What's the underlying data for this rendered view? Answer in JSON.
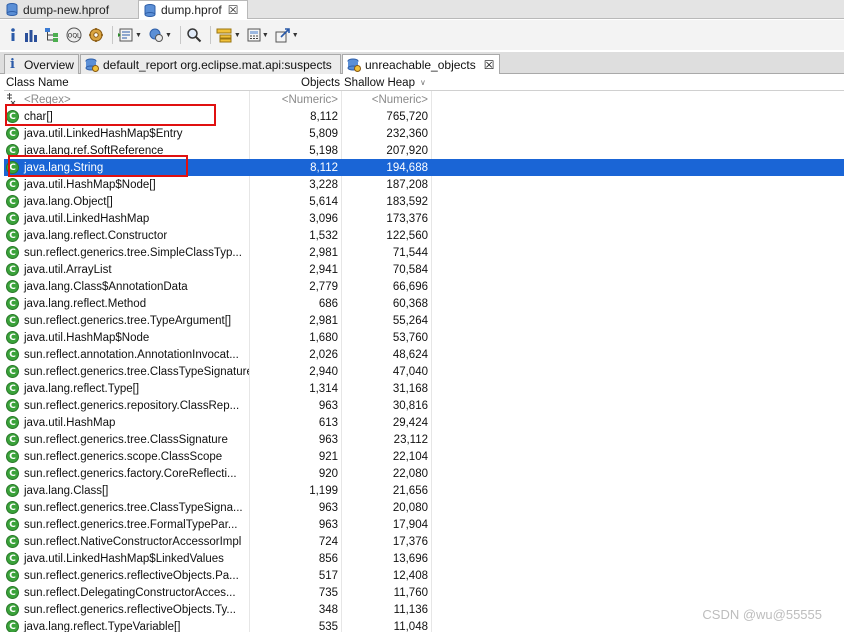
{
  "editor_tabs": [
    {
      "label": "dump-new.hprof",
      "active": false
    },
    {
      "label": "dump.hprof",
      "active": true,
      "close": "☒"
    }
  ],
  "toolbar": {
    "buttons": [
      {
        "icon": "info-icon"
      },
      {
        "icon": "histogram-icon"
      },
      {
        "icon": "dominator-tree-icon"
      },
      {
        "icon": "oql-icon"
      },
      {
        "icon": "heap-dump-overview-icon"
      },
      {
        "icon": "query-browser-icon"
      },
      {
        "icon": "find-object-icon"
      },
      {
        "icon": "search-icon"
      },
      {
        "icon": "group-by-icon"
      },
      {
        "icon": "calculator-icon"
      },
      {
        "icon": "export-icon"
      }
    ]
  },
  "view_tabs": [
    {
      "label": "Overview",
      "icon": "info-icon"
    },
    {
      "label": "default_report  org.eclipse.mat.api:suspects",
      "icon": "report-icon"
    },
    {
      "label": "unreachable_objects",
      "icon": "report-icon",
      "active": true,
      "close": "☒"
    }
  ],
  "table": {
    "columns": [
      "Class Name",
      "Objects",
      "Shallow Heap"
    ],
    "filter_row": [
      "<Regex>",
      "<Numeric>",
      "<Numeric>"
    ],
    "rows": [
      {
        "name": "char[]",
        "objects": "8,112",
        "shallow_heap": "765,720"
      },
      {
        "name": "java.util.LinkedHashMap$Entry",
        "objects": "5,809",
        "shallow_heap": "232,360"
      },
      {
        "name": "java.lang.ref.SoftReference",
        "objects": "5,198",
        "shallow_heap": "207,920"
      },
      {
        "name": "java.lang.String",
        "objects": "8,112",
        "shallow_heap": "194,688",
        "selected": true
      },
      {
        "name": "java.util.HashMap$Node[]",
        "objects": "3,228",
        "shallow_heap": "187,208"
      },
      {
        "name": "java.lang.Object[]",
        "objects": "5,614",
        "shallow_heap": "183,592"
      },
      {
        "name": "java.util.LinkedHashMap",
        "objects": "3,096",
        "shallow_heap": "173,376"
      },
      {
        "name": "java.lang.reflect.Constructor",
        "objects": "1,532",
        "shallow_heap": "122,560"
      },
      {
        "name": "sun.reflect.generics.tree.SimpleClassTyp...",
        "objects": "2,981",
        "shallow_heap": "71,544"
      },
      {
        "name": "java.util.ArrayList",
        "objects": "2,941",
        "shallow_heap": "70,584"
      },
      {
        "name": "java.lang.Class$AnnotationData",
        "objects": "2,779",
        "shallow_heap": "66,696"
      },
      {
        "name": "java.lang.reflect.Method",
        "objects": "686",
        "shallow_heap": "60,368"
      },
      {
        "name": "sun.reflect.generics.tree.TypeArgument[]",
        "objects": "2,981",
        "shallow_heap": "55,264"
      },
      {
        "name": "java.util.HashMap$Node",
        "objects": "1,680",
        "shallow_heap": "53,760"
      },
      {
        "name": "sun.reflect.annotation.AnnotationInvocat...",
        "objects": "2,026",
        "shallow_heap": "48,624"
      },
      {
        "name": "sun.reflect.generics.tree.ClassTypeSignature",
        "objects": "2,940",
        "shallow_heap": "47,040"
      },
      {
        "name": "java.lang.reflect.Type[]",
        "objects": "1,314",
        "shallow_heap": "31,168"
      },
      {
        "name": "sun.reflect.generics.repository.ClassRep...",
        "objects": "963",
        "shallow_heap": "30,816"
      },
      {
        "name": "java.util.HashMap",
        "objects": "613",
        "shallow_heap": "29,424"
      },
      {
        "name": "sun.reflect.generics.tree.ClassSignature",
        "objects": "963",
        "shallow_heap": "23,112"
      },
      {
        "name": "sun.reflect.generics.scope.ClassScope",
        "objects": "921",
        "shallow_heap": "22,104"
      },
      {
        "name": "sun.reflect.generics.factory.CoreReflecti...",
        "objects": "920",
        "shallow_heap": "22,080"
      },
      {
        "name": "java.lang.Class[]",
        "objects": "1,199",
        "shallow_heap": "21,656"
      },
      {
        "name": "sun.reflect.generics.tree.ClassTypeSigna...",
        "objects": "963",
        "shallow_heap": "20,080"
      },
      {
        "name": "sun.reflect.generics.tree.FormalTypePar...",
        "objects": "963",
        "shallow_heap": "17,904"
      },
      {
        "name": "sun.reflect.NativeConstructorAccessorImpl",
        "objects": "724",
        "shallow_heap": "17,376"
      },
      {
        "name": "java.util.LinkedHashMap$LinkedValues",
        "objects": "856",
        "shallow_heap": "13,696"
      },
      {
        "name": "sun.reflect.generics.reflectiveObjects.Pa...",
        "objects": "517",
        "shallow_heap": "12,408"
      },
      {
        "name": "sun.reflect.DelegatingConstructorAcces...",
        "objects": "735",
        "shallow_heap": "11,760"
      },
      {
        "name": "sun.reflect.generics.reflectiveObjects.Ty...",
        "objects": "348",
        "shallow_heap": "11,136"
      },
      {
        "name": "java.lang.reflect.TypeVariable[]",
        "objects": "535",
        "shallow_heap": "11,048"
      }
    ]
  },
  "watermark": "CSDN @wu@55555",
  "colors": {
    "selection": "#1a65d6",
    "highlight_box": "#e01010",
    "class_icon": "#3aa23a"
  }
}
